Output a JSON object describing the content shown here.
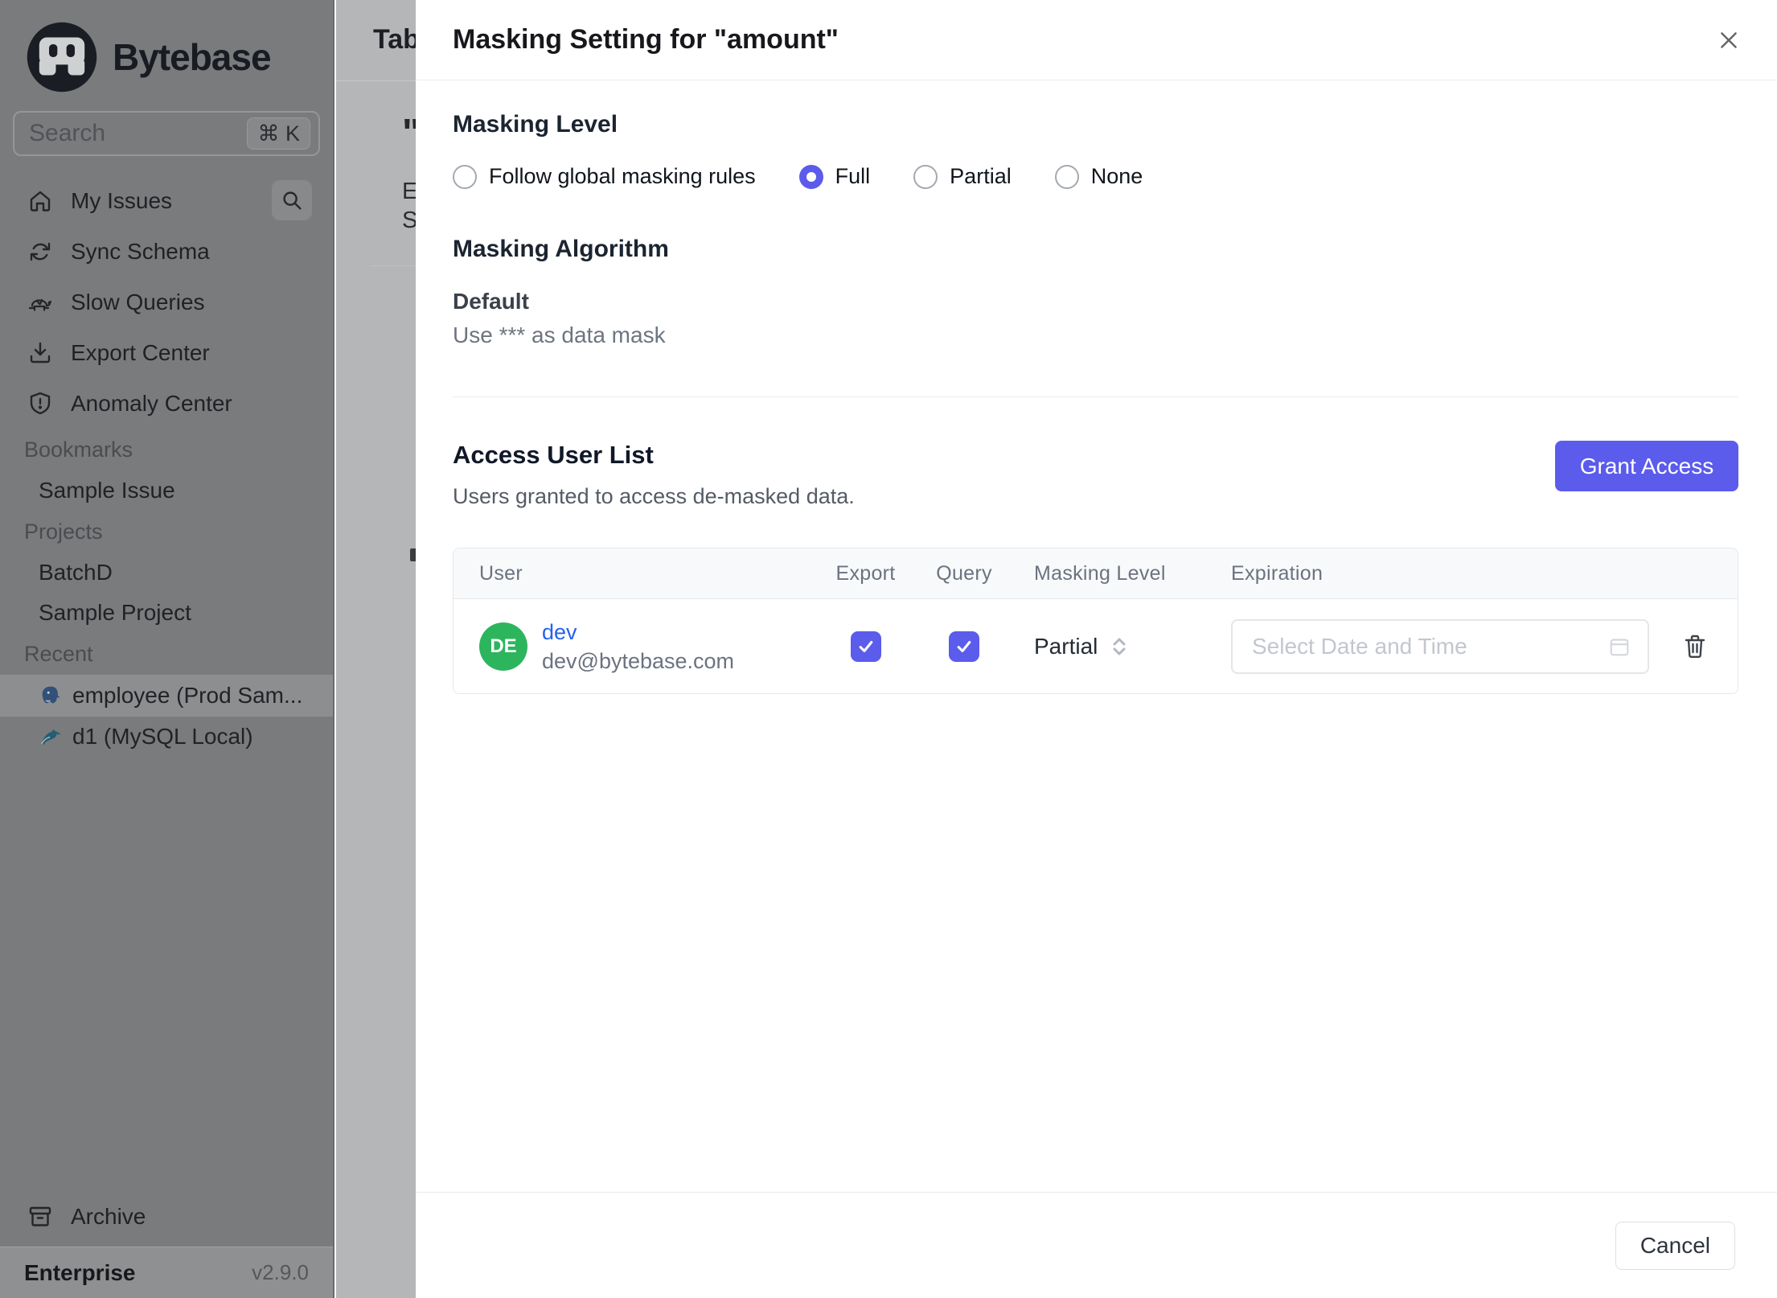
{
  "colors": {
    "accent": "#5b5bec",
    "link_blue": "#2563eb",
    "avatar_green": "#2db55d"
  },
  "sidebar": {
    "logo_text": "Bytebase",
    "search": {
      "placeholder": "Search",
      "shortcut": "⌘ K"
    },
    "items": [
      {
        "label": "My Issues",
        "icon": "home-icon"
      },
      {
        "label": "Sync Schema",
        "icon": "sync-icon"
      },
      {
        "label": "Slow Queries",
        "icon": "turtle-icon"
      },
      {
        "label": "Export Center",
        "icon": "download-icon"
      },
      {
        "label": "Anomaly Center",
        "icon": "shield-icon"
      }
    ],
    "sections": [
      {
        "label": "Bookmarks",
        "children": [
          {
            "label": "Sample Issue"
          }
        ]
      },
      {
        "label": "Projects",
        "children": [
          {
            "label": "BatchD"
          },
          {
            "label": "Sample Project"
          }
        ]
      },
      {
        "label": "Recent",
        "children": [
          {
            "label": "employee (Prod Sam...",
            "icon": "postgresql-icon",
            "selected": true
          },
          {
            "label": "d1 (MySQL Local)",
            "icon": "mysql-icon",
            "selected": false
          }
        ]
      }
    ],
    "archive_label": "Archive",
    "plan": "Enterprise",
    "version": "v2.9.0"
  },
  "background_page": {
    "clipped_title": "Tab",
    "clipped_quote": "\"",
    "clipped_line_1": "E",
    "clipped_line_2": "S"
  },
  "modal": {
    "title": "Masking Setting for \"amount\"",
    "masking_level": {
      "heading": "Masking Level",
      "options": [
        {
          "label": "Follow global masking rules",
          "selected": false
        },
        {
          "label": "Full",
          "selected": true
        },
        {
          "label": "Partial",
          "selected": false
        },
        {
          "label": "None",
          "selected": false
        }
      ]
    },
    "masking_algorithm": {
      "heading": "Masking Algorithm",
      "name": "Default",
      "description": "Use *** as data mask"
    },
    "access_user_list": {
      "heading": "Access User List",
      "subtitle": "Users granted to access de-masked data.",
      "grant_button": "Grant Access",
      "table": {
        "columns": [
          "User",
          "Export",
          "Query",
          "Masking Level",
          "Expiration"
        ],
        "rows": [
          {
            "avatar_initials": "DE",
            "name": "dev",
            "email": "dev@bytebase.com",
            "export": true,
            "query": true,
            "masking_level": "Partial",
            "expiration_placeholder": "Select Date and Time"
          }
        ]
      }
    },
    "footer": {
      "cancel_label": "Cancel"
    }
  }
}
